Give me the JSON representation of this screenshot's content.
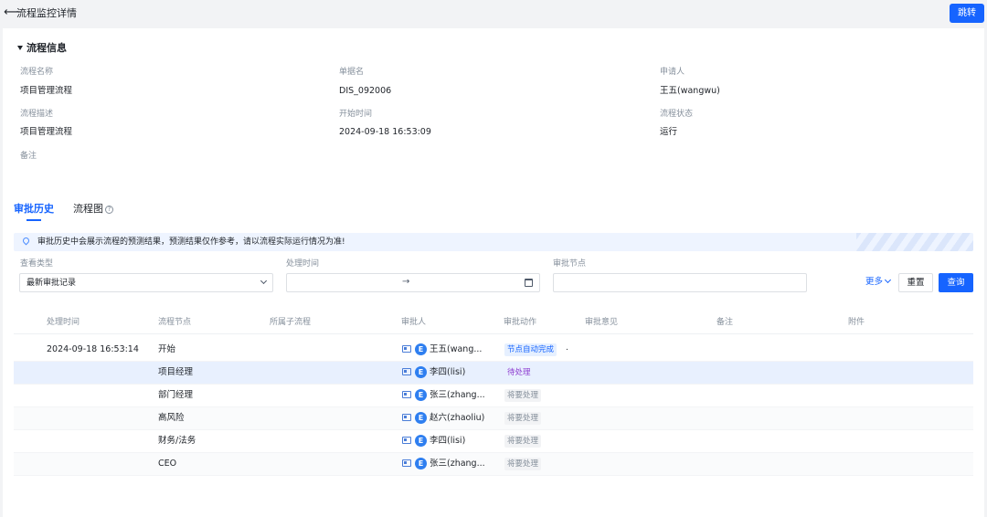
{
  "header": {
    "back_icon": "arrow-left-icon",
    "title": "流程监控详情",
    "jump_label": "跳转",
    "accent": "#1664ff"
  },
  "info": {
    "section_title": "流程信息",
    "fields": {
      "process_name": {
        "label": "流程名称",
        "value": "项目管理流程"
      },
      "doc_name": {
        "label": "单据名",
        "value": "DIS_092006"
      },
      "applicant": {
        "label": "申请人",
        "value": "王五(wangwu)"
      },
      "description": {
        "label": "流程描述",
        "value": "项目管理流程"
      },
      "start_time": {
        "label": "开始时间",
        "value": "2024-09-18 16:53:09"
      },
      "status": {
        "label": "流程状态",
        "value": "运行"
      },
      "remark": {
        "label": "备注",
        "value": ""
      }
    }
  },
  "tabs": [
    {
      "label": "审批历史",
      "active": true
    },
    {
      "label": "流程图",
      "active": false,
      "icon": "help-circle-icon"
    }
  ],
  "notice": {
    "icon": "location-pin-icon",
    "text": "审批历史中会展示流程的预测结果，预测结果仅作参考，请以流程实际运行情况为准!"
  },
  "filters": {
    "view_type": {
      "label": "查看类型",
      "value": "最新审批记录"
    },
    "time": {
      "label": "处理时间",
      "separator": "→"
    },
    "node": {
      "label": "审批节点",
      "value": ""
    },
    "more_label": "更多",
    "reset_label": "重置",
    "query_label": "查询"
  },
  "table": {
    "columns": [
      "处理时间",
      "流程节点",
      "所属子流程",
      "审批人",
      "审批动作",
      "审批意见",
      "备注",
      "附件"
    ],
    "rows": [
      {
        "time": "2024-09-18 16:53:14",
        "node": "开始",
        "sub": "",
        "avatar": "E",
        "approver": "王五(wang...",
        "action": "节点自动完成",
        "action_type": "auto",
        "opinion": ".",
        "remark": "",
        "attach": ""
      },
      {
        "time": "",
        "node": "项目经理",
        "sub": "",
        "avatar": "E",
        "approver": "李四(lisi)",
        "action": "待处理",
        "action_type": "pending",
        "opinion": "",
        "remark": "",
        "attach": ""
      },
      {
        "time": "",
        "node": "部门经理",
        "sub": "",
        "avatar": "E",
        "approver": "张三(zhang...",
        "action": "将要处理",
        "action_type": "todo",
        "opinion": "",
        "remark": "",
        "attach": ""
      },
      {
        "time": "",
        "node": "高风险",
        "sub": "",
        "avatar": "E",
        "approver": "赵六(zhaoliu)",
        "action": "将要处理",
        "action_type": "todo",
        "opinion": "",
        "remark": "",
        "attach": ""
      },
      {
        "time": "",
        "node": "财务/法务",
        "sub": "",
        "avatar": "E",
        "approver": "李四(lisi)",
        "action": "将要处理",
        "action_type": "todo",
        "opinion": "",
        "remark": "",
        "attach": ""
      },
      {
        "time": "",
        "node": "CEO",
        "sub": "",
        "avatar": "E",
        "approver": "张三(zhang...",
        "action": "将要处理",
        "action_type": "todo",
        "opinion": "",
        "remark": "",
        "attach": ""
      }
    ]
  }
}
